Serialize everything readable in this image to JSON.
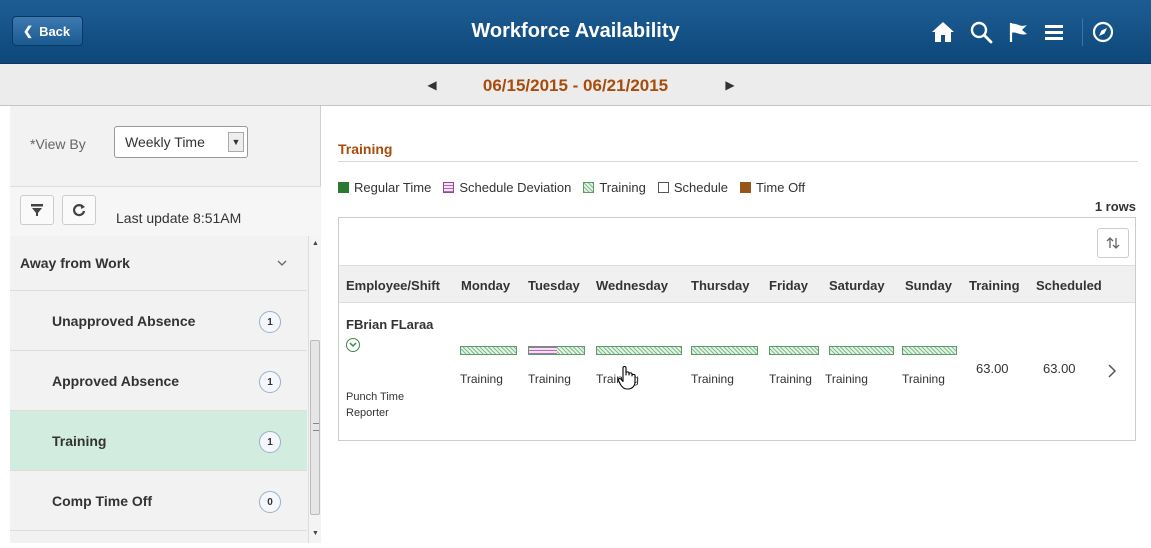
{
  "header": {
    "back_label": "Back",
    "title": "Workforce Availability",
    "icons": [
      "home-icon",
      "search-icon",
      "flag-icon",
      "menu-icon",
      "compass-icon"
    ]
  },
  "date_nav": {
    "range": "06/15/2015 - 06/21/2015"
  },
  "left_panel": {
    "view_by_label": "*View By",
    "view_by_value": "Weekly Time",
    "last_update": "Last update 8:51AM",
    "heading": "Away from Work",
    "items": [
      {
        "label": "Unapproved Absence",
        "count": "1"
      },
      {
        "label": "Approved Absence",
        "count": "1"
      },
      {
        "label": "Training",
        "count": "1"
      },
      {
        "label": "Comp Time Off",
        "count": "0"
      }
    ]
  },
  "main": {
    "section_title": "Training",
    "legend": [
      {
        "label": "Regular Time",
        "color": "#2c7a32"
      },
      {
        "label": "Schedule Deviation",
        "color": "#b46bb0"
      },
      {
        "label": "Training",
        "color": "#7fbe8d"
      },
      {
        "label": "Schedule",
        "color": "#ffffff"
      },
      {
        "label": "Time Off",
        "color": "#96561b"
      }
    ],
    "rows_count": "1 rows",
    "columns": [
      "Employee/Shift",
      "Monday",
      "Tuesday",
      "Wednesday",
      "Thursday",
      "Friday",
      "Saturday",
      "Sunday",
      "Training",
      "Scheduled"
    ],
    "row": {
      "employee": "FBrian FLaraa",
      "role": "Punch Time Reporter",
      "days": [
        "Training",
        "Training",
        "Training",
        "Training",
        "Training",
        "Training",
        "Training"
      ],
      "training_hours": "63.00",
      "scheduled_hours": "63.00"
    }
  }
}
